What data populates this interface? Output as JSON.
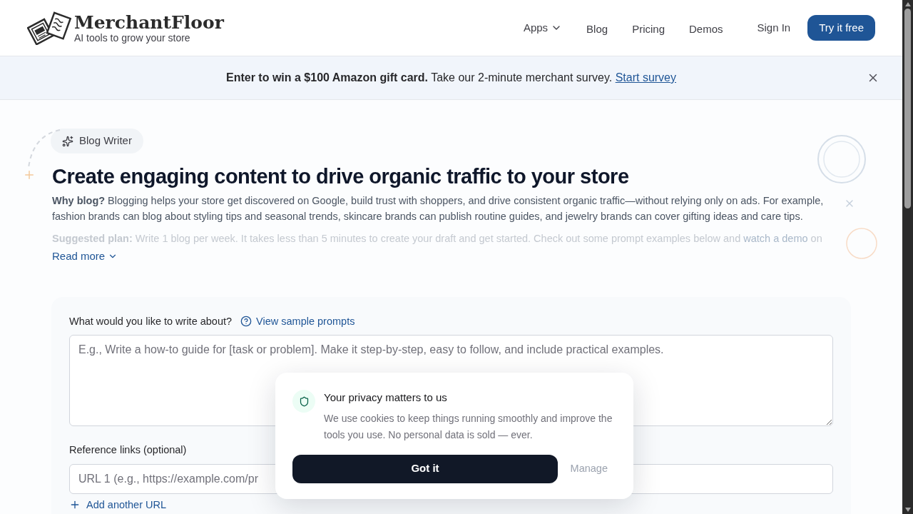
{
  "header": {
    "brand": "MerchantFloor",
    "tagline": "AI tools to grow your store",
    "nav": [
      {
        "label": "Apps",
        "kind": "dropdown"
      },
      {
        "label": "Blog",
        "kind": "link"
      },
      {
        "label": "Pricing",
        "kind": "link"
      },
      {
        "label": "Demos",
        "kind": "link"
      }
    ],
    "sign_in": "Sign In",
    "cta": "Try it free"
  },
  "banner": {
    "bold": "Enter to win a $100 Amazon gift card.",
    "text": "Take our 2-minute merchant survey.",
    "link": "Start survey"
  },
  "hero": {
    "badge": "Blog Writer",
    "title": "Create engaging content to drive organic traffic to your store",
    "why": "**Why blog?** Blogging helps your store get discovered on Google, build trust with shoppers, and drive consistent organic traffic—without relying only on ads. For example, fashion brands can blog about styling tips and seasonal trends, skincare brands can publish routine guides, and jewelry brands can cover gifting ideas and care tips.",
    "plan_label": "Suggested plan:",
    "plan_text": "Write 1 blog per week. It takes less than 5 minutes to create your draft and get started. Check out some prompt examples below and",
    "plan_link": "watch a demo",
    "plan_tail": "on",
    "read_more": "Read more"
  },
  "form": {
    "topic_label": "What would you like to write about?",
    "sample_link": "View sample prompts",
    "topic_placeholder": "E.g., Write a how-to guide for [task or problem]. Make it step-by-step, easy to follow, and include practical examples.",
    "links_label": "Reference links (optional)",
    "url_placeholder": "URL 1 (e.g., https://example.com/pr",
    "add_url": "Add another URL"
  },
  "cookie": {
    "title": "Your privacy matters to us",
    "text": "We use cookies to keep things running smoothly and improve the tools you use. No personal data is sold — ever.",
    "accept": "Got it",
    "manage": "Manage"
  }
}
